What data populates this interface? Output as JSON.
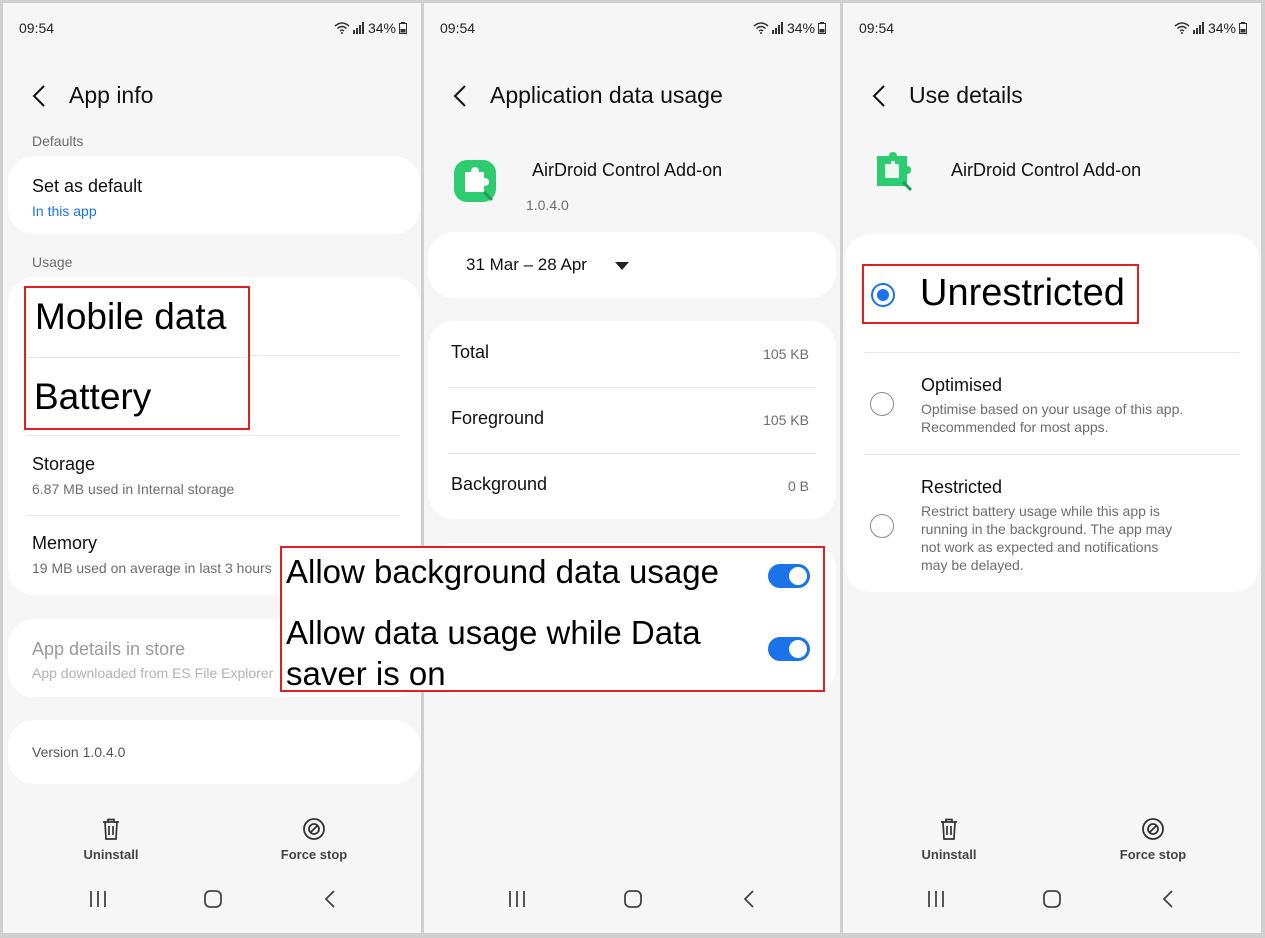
{
  "status": {
    "time": "09:54",
    "battery": "34%"
  },
  "panel1": {
    "title": "App info",
    "defaults_label": "Defaults",
    "set_as_default": {
      "title": "Set as default",
      "sub": "In this app"
    },
    "usage_label": "Usage",
    "mobile_data": "Mobile data",
    "battery": "Battery",
    "storage": {
      "title": "Storage",
      "sub": "6.87 MB used in Internal storage"
    },
    "memory": {
      "title": "Memory",
      "sub": "19 MB used on average in last 3 hours"
    },
    "store": {
      "title": "App details in store",
      "sub": "App downloaded from ES File Explorer"
    },
    "version": "Version 1.0.4.0",
    "uninstall": "Uninstall",
    "force_stop": "Force stop"
  },
  "panel2": {
    "title": "Application data usage",
    "app_name": "AirDroid Control Add-on",
    "app_version": "1.0.4.0",
    "date_range": "31 Mar – 28 Apr",
    "rows": [
      {
        "label": "Total",
        "value": "105 KB"
      },
      {
        "label": "Foreground",
        "value": "105 KB"
      },
      {
        "label": "Background",
        "value": "0 B"
      }
    ],
    "allow_background": "Allow background data usage",
    "allow_saver_line1": "Allow data usage while Data",
    "allow_saver_line2": "saver is on"
  },
  "panel3": {
    "title": "Use details",
    "app_name": "AirDroid Control Add-on",
    "unrestricted": "Unrestricted",
    "optimised": {
      "title": "Optimised",
      "sub1": "Optimise based on your usage of this app.",
      "sub2": "Recommended for most apps."
    },
    "restricted": {
      "title": "Restricted",
      "sub1": "Restrict battery usage while this app is",
      "sub2": "running in the background. The app may",
      "sub3": "not work as expected and notifications",
      "sub4": "may be delayed."
    },
    "uninstall": "Uninstall",
    "force_stop": "Force stop"
  },
  "colors": {
    "accent": "#1a73e8",
    "highlight": "#e02020",
    "app_green": "#2ecc71"
  }
}
